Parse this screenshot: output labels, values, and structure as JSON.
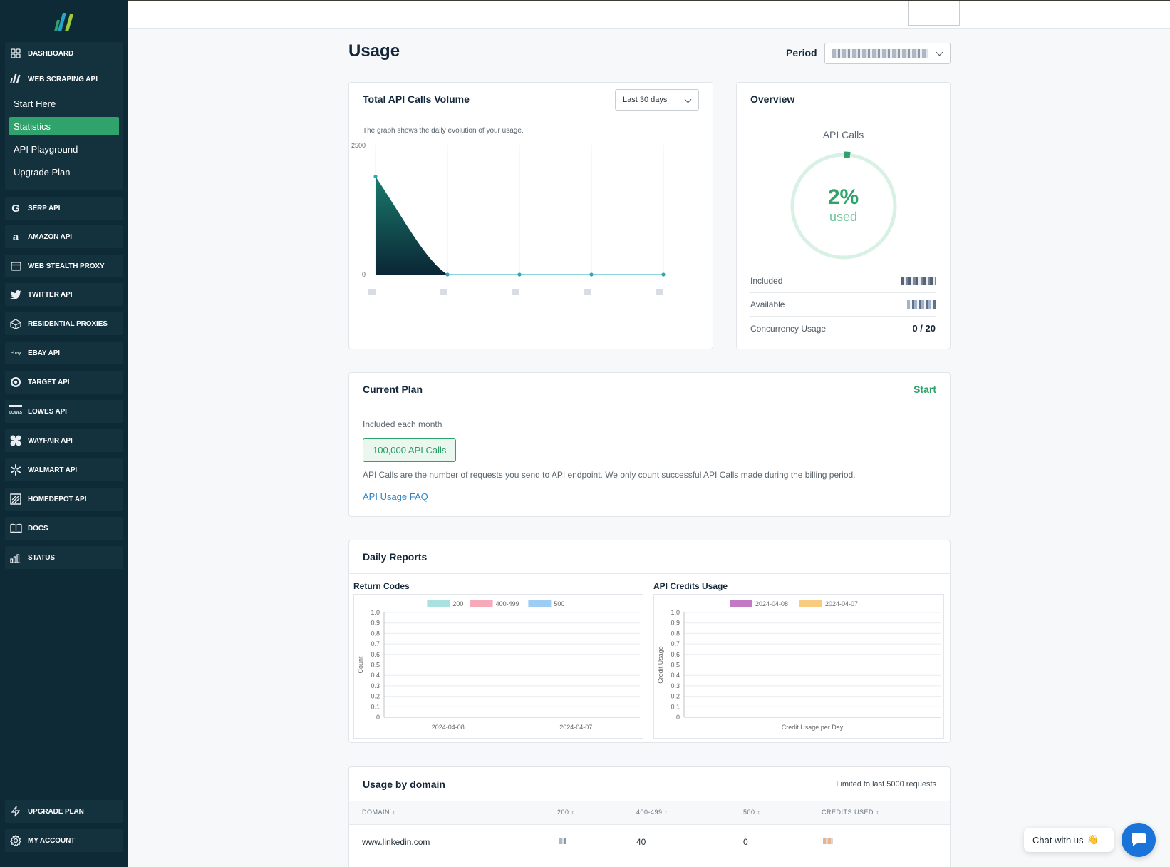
{
  "sidebar": {
    "dashboard": "DASHBOARD",
    "web_scraping": {
      "label": "WEB SCRAPING API",
      "items": [
        "Start Here",
        "Statistics",
        "API Playground",
        "Upgrade Plan"
      ],
      "active": "Statistics"
    },
    "apis": [
      "SERP API",
      "AMAZON API",
      "WEB STEALTH PROXY",
      "TWITTER API",
      "RESIDENTIAL PROXIES",
      "EBAY API",
      "TARGET API",
      "LOWES API",
      "WAYFAIR API",
      "WALMART API",
      "HOMEDEPOT API",
      "DOCS",
      "STATUS"
    ],
    "ebay_logo_text": "ebay",
    "lowes_logo_text": "LOWES",
    "upgrade_plan": "UPGRADE PLAN",
    "my_account": "MY ACCOUNT"
  },
  "page": {
    "title": "Usage",
    "period_label": "Period"
  },
  "volume": {
    "title": "Total API Calls Volume",
    "range": "Last 30 days",
    "caption": "The graph shows the daily evolution of your usage.",
    "chart_data": {
      "type": "area",
      "title": "",
      "ylim": [
        0,
        2500
      ],
      "y_ticks": [
        "2500",
        "0"
      ],
      "values": [
        1900,
        0,
        0,
        0,
        0
      ]
    }
  },
  "overview": {
    "title": "Overview",
    "gauge_label": "API Calls",
    "percent": "2%",
    "used": "used",
    "percent_value": 2,
    "rows": [
      {
        "label": "Included",
        "value": ""
      },
      {
        "label": "Available",
        "value": ""
      },
      {
        "label": "Concurrency Usage",
        "value": "0 / 20"
      }
    ]
  },
  "plan": {
    "title": "Current Plan",
    "name": "Start",
    "included_label": "Included each month",
    "badge": "100,000 API Calls",
    "description": "API Calls are the number of requests you send to API endpoint. We only count successful API Calls made during the billing period.",
    "faq_link": "API Usage FAQ"
  },
  "daily": {
    "title": "Daily Reports",
    "return_codes": {
      "title": "Return Codes",
      "chart_data": {
        "type": "bar",
        "categories": [
          "2024-04-08",
          "2024-04-07"
        ],
        "series": [
          {
            "name": "200",
            "values": [
              0,
              0
            ],
            "color": "#a8e1dd"
          },
          {
            "name": "400-499",
            "values": [
              0,
              0
            ],
            "color": "#f6a9b9"
          },
          {
            "name": "500",
            "values": [
              0,
              0
            ],
            "color": "#9dcdf2"
          }
        ],
        "ylabel": "Count",
        "ylim": [
          0,
          1.0
        ],
        "y_ticks": [
          "1.0",
          "0.9",
          "0.8",
          "0.7",
          "0.6",
          "0.5",
          "0.4",
          "0.3",
          "0.2",
          "0.1",
          "0"
        ]
      }
    },
    "credits": {
      "title": "API Credits Usage",
      "chart_data": {
        "type": "bar",
        "categories": [],
        "series": [
          {
            "name": "2024-04-08",
            "values": [],
            "color": "#c27ac4"
          },
          {
            "name": "2024-04-07",
            "values": [],
            "color": "#f8cc7e"
          }
        ],
        "xlabel": "Credit Usage per Day",
        "ylabel": "Credit Usage",
        "ylim": [
          0,
          1.0
        ],
        "y_ticks": [
          "1.0",
          "0.9",
          "0.8",
          "0.7",
          "0.6",
          "0.5",
          "0.4",
          "0.3",
          "0.2",
          "0.1",
          "0"
        ]
      }
    }
  },
  "domain": {
    "title": "Usage by domain",
    "note": "Limited to last 5000 requests",
    "columns": [
      "DOMAIN ↕",
      "200 ↕",
      "400-499 ↕",
      "500 ↕",
      "CREDITS USED ↕"
    ],
    "rows": [
      {
        "domain": "www.linkedin.com",
        "c200": "",
        "c400": "40",
        "c500": "0",
        "credits": ""
      }
    ]
  },
  "chat": {
    "label": "Chat with us",
    "emoji": "👋"
  }
}
